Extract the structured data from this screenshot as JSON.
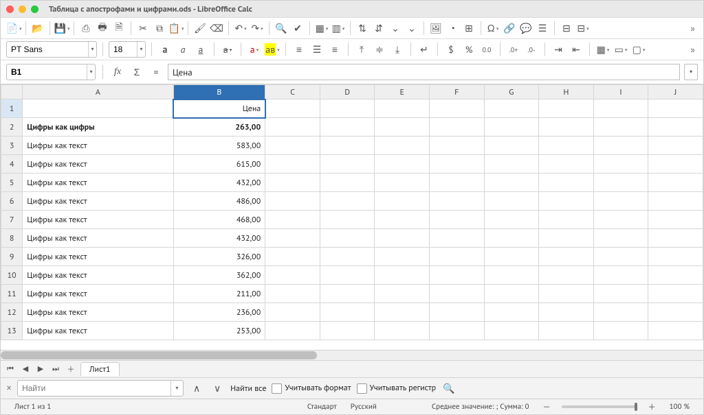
{
  "title": "Таблица с апострофами и цифрами.ods - LibreOffice Calc",
  "font_name": "PT Sans",
  "font_size": "18",
  "cell_ref": "B1",
  "formula_value": "Цена",
  "columns": [
    "A",
    "B",
    "C",
    "D",
    "E",
    "F",
    "G",
    "H",
    "I",
    "J"
  ],
  "selected_column_index": 1,
  "rows": [
    {
      "n": "1",
      "a": "",
      "b": "Цена",
      "sel": true
    },
    {
      "n": "2",
      "a": "Цифры как цифры",
      "b": "263,00",
      "bold": true
    },
    {
      "n": "3",
      "a": "Цифры как текст",
      "b": "583,00"
    },
    {
      "n": "4",
      "a": "Цифры как текст",
      "b": "615,00"
    },
    {
      "n": "5",
      "a": "Цифры как текст",
      "b": "432,00"
    },
    {
      "n": "6",
      "a": "Цифры как текст",
      "b": "486,00"
    },
    {
      "n": "7",
      "a": "Цифры как текст",
      "b": "468,00"
    },
    {
      "n": "8",
      "a": "Цифры как текст",
      "b": "432,00"
    },
    {
      "n": "9",
      "a": "Цифры как текст",
      "b": "326,00"
    },
    {
      "n": "10",
      "a": "Цифры как текст",
      "b": "362,00"
    },
    {
      "n": "11",
      "a": "Цифры как текст",
      "b": "211,00"
    },
    {
      "n": "12",
      "a": "Цифры как текст",
      "b": "236,00"
    },
    {
      "n": "13",
      "a": "Цифры как текст",
      "b": "253,00"
    }
  ],
  "sheet_tab": "Лист1",
  "find": {
    "placeholder": "Найти",
    "find_all": "Найти все",
    "match_format": "Учитывать формат",
    "match_case": "Учитывать регистр"
  },
  "status": {
    "sheet_of": "Лист 1 из 1",
    "standard": "Стандарт",
    "lang": "Русский",
    "summary": "Среднее значение: ; Сумма: 0",
    "zoom": "100 %"
  },
  "icons": {
    "bold": "a",
    "italic": "a",
    "underline": "a",
    "strike": "a",
    "fontcolor": "a",
    "highlight": "ав"
  }
}
